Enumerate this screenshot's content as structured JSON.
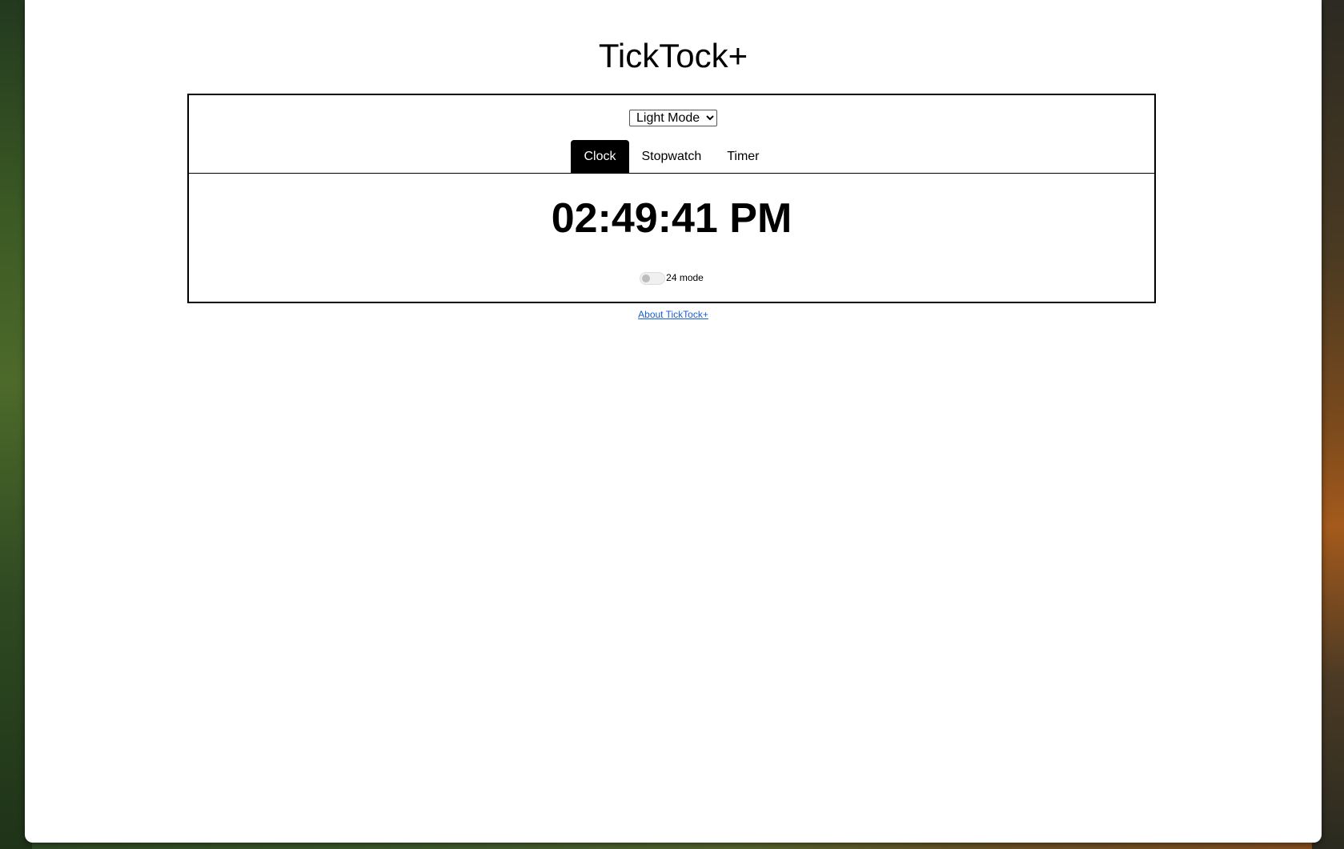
{
  "app": {
    "title": "TickTock+"
  },
  "theme_select": {
    "selected": "Light Mode",
    "options": [
      "Light Mode"
    ]
  },
  "tabs": [
    {
      "label": "Clock",
      "active": true
    },
    {
      "label": "Stopwatch",
      "active": false
    },
    {
      "label": "Timer",
      "active": false
    }
  ],
  "clock": {
    "time": "02:49:41 PM",
    "toggle_label": "24 mode",
    "toggle_on": false
  },
  "footer": {
    "about_link": "About TickTock+"
  },
  "colors": {
    "active_tab_bg": "#000000",
    "link": "#1a5fd0"
  }
}
